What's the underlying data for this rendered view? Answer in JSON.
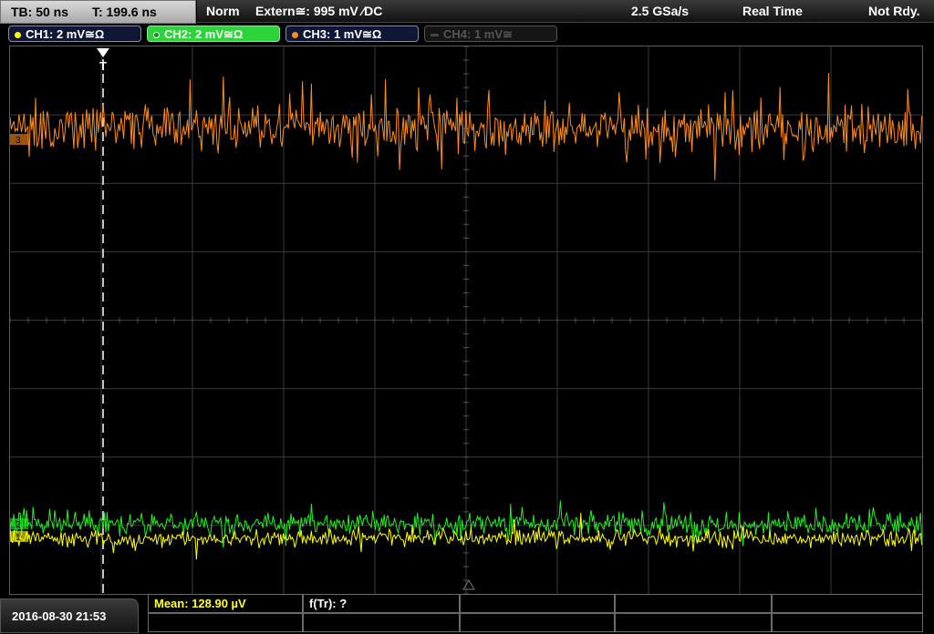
{
  "timebase": {
    "tb_label": "TB: 50 ns",
    "t_label": "T: 199.6 ns"
  },
  "status": {
    "mode": "Norm",
    "trigger": "Extern≅: 995 mV ∕DC",
    "sample_rate": "2.5 GSa/s",
    "acq_mode": "Real Time",
    "ready_state": "Not Rdy."
  },
  "channels": [
    {
      "label": "CH1: 2 mV≅Ω",
      "color": "#ffff00",
      "state": "on"
    },
    {
      "label": "CH2: 2 mV≅Ω",
      "color": "#22ee22",
      "state": "selected"
    },
    {
      "label": "CH3: 1 mV≅Ω",
      "color": "#ff8c1a",
      "state": "on"
    },
    {
      "label": "CH4: 1 mV≅",
      "color": "#555555",
      "state": "off"
    }
  ],
  "markers": {
    "trigger_marker": "T",
    "ch3_level": "3",
    "ch2_level": "2",
    "ch1_level": "1"
  },
  "datetime": "2016-08-30 21:53",
  "measurements": {
    "mean": "Mean: 128.90 µV",
    "freq": "f(Tr): ?"
  }
}
